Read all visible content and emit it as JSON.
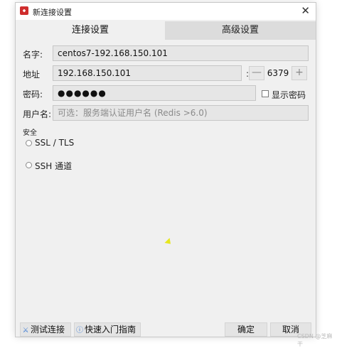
{
  "window": {
    "title": "新连接设置",
    "close_glyph": "✕"
  },
  "tabs": [
    {
      "label": "连接设置",
      "active": true
    },
    {
      "label": "高级设置",
      "active": false
    }
  ],
  "form": {
    "name_label": "名字:",
    "name_value": "centos7-192.168.150.101",
    "address_label": "地址",
    "address_value": "192.168.150.101",
    "port_separator": ":",
    "port_value": "6379",
    "decrement_glyph": "—",
    "increment_glyph": "+",
    "password_label": "密码:",
    "password_value": "●●●●●●",
    "show_password_label": "显示密码",
    "show_password_checked": false,
    "username_label": "用户名:",
    "username_placeholder": "可选：服务端认证用户名 (Redis >6.0)"
  },
  "security": {
    "section_label": "安全",
    "options": [
      {
        "label": "SSL / TLS",
        "selected": false
      },
      {
        "label": "SSH 通道",
        "selected": false
      }
    ]
  },
  "footer": {
    "test_connection_label": "测试连接",
    "test_connection_icon": "plug-icon",
    "quick_start_label": "快速入门指南",
    "quick_start_icon": "help-icon",
    "ok_label": "确定",
    "cancel_label": "取消"
  },
  "watermark": "CSDN @芝麻干",
  "colors": {
    "app_icon": "#cf2d2d",
    "window_bg": "#f0f0f0",
    "inactive_tab": "#dcdcdc"
  }
}
